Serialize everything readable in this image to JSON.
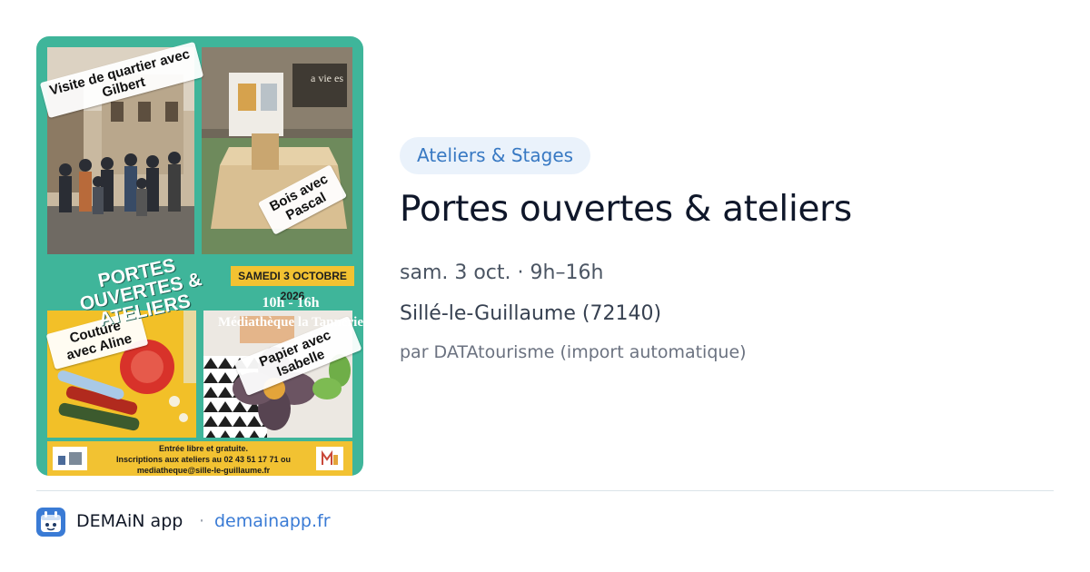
{
  "poster": {
    "tile_labels": {
      "visite": "Visite de quartier avec Gilbert",
      "bois": "Bois avec Pascal",
      "couture": "Couture avec Aline",
      "papier": "Papier avec Isabelle"
    },
    "title": "PORTES OUVERTES & ATELIERS",
    "date": "SAMEDI 3 OCTOBRE 2026",
    "hours": "10h - 16h",
    "place": "Médiathèque la Tannerie",
    "footer_line1": "Entrée libre et gratuite.",
    "footer_line2": "Inscriptions aux ateliers au 02 43 51 17 71 ou",
    "footer_line3": "mediatheque@sille-le-guillaume.fr",
    "shop_sign": "a vie es",
    "colors": {
      "background": "#3fb59a",
      "band": "#f2c232"
    }
  },
  "event": {
    "category": "Ateliers & Stages",
    "title": "Portes ouvertes & ateliers",
    "date": "sam. 3 oct. · 9h–16h",
    "location": "Sillé-le-Guillaume (72140)",
    "source": "par DATAtourisme (import automatique)"
  },
  "footer": {
    "app_name": "DEMAiN app",
    "separator": "·",
    "link": "demainapp.fr",
    "icon": "app-logo-icon"
  },
  "colors": {
    "accent": "#3a7bd5",
    "badge_bg": "#eaf2fb",
    "badge_text": "#3879c3"
  }
}
